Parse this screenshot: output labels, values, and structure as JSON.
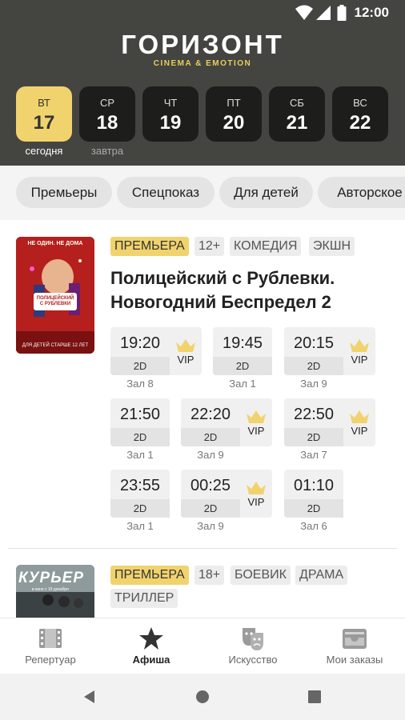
{
  "status_bar": {
    "time": "12:00"
  },
  "brand": {
    "name": "ГОРИЗОНТ",
    "tagline": "CINEMA & EMOTION"
  },
  "days": [
    {
      "weekday": "ВТ",
      "date": "17",
      "label": "сегодня",
      "active": true
    },
    {
      "weekday": "СР",
      "date": "18",
      "label": "завтра",
      "active": false
    },
    {
      "weekday": "ЧТ",
      "date": "19",
      "label": "",
      "active": false
    },
    {
      "weekday": "ПТ",
      "date": "20",
      "label": "",
      "active": false
    },
    {
      "weekday": "СБ",
      "date": "21",
      "label": "",
      "active": false
    },
    {
      "weekday": "ВС",
      "date": "22",
      "label": "",
      "active": false
    }
  ],
  "filters": [
    "Премьеры",
    "Спецпоказ",
    "Для детей",
    "Авторское"
  ],
  "movies": [
    {
      "poster": {
        "top_text": "НЕ ОДИН. НЕ ДОМА",
        "title_text": "ПОЛИЦЕЙСКИЙ С РУБЛЕВКИ",
        "bottom_text": "ДЛЯ ДЕТЕЙ СТАРШЕ 12 ЛЕТ"
      },
      "badges": [
        "ПРЕМЬЕРА",
        "12+",
        "КОМЕДИЯ",
        "ЭКШН"
      ],
      "title_line1": "Полицейский с Рублевки.",
      "title_line2": "Новогодний Беспредел 2",
      "sessions": [
        {
          "time": "19:20",
          "format": "2D",
          "hall": "Зал 8",
          "vip": "VIP"
        },
        {
          "time": "19:45",
          "format": "2D",
          "hall": "Зал 1",
          "vip": ""
        },
        {
          "time": "20:15",
          "format": "2D",
          "hall": "Зал 9",
          "vip": "VIP"
        },
        {
          "time": "21:50",
          "format": "2D",
          "hall": "Зал 1",
          "vip": ""
        },
        {
          "time": "22:20",
          "format": "2D",
          "hall": "Зал 9",
          "vip": "VIP"
        },
        {
          "time": "22:50",
          "format": "2D",
          "hall": "Зал 7",
          "vip": "VIP"
        },
        {
          "time": "23:55",
          "format": "2D",
          "hall": "Зал 1",
          "vip": ""
        },
        {
          "time": "00:25",
          "format": "2D",
          "hall": "Зал 9",
          "vip": "VIP"
        },
        {
          "time": "01:10",
          "format": "2D",
          "hall": "Зал 6",
          "vip": ""
        }
      ]
    },
    {
      "poster": {
        "title_text": "КУРЬЕР",
        "sub_text": "в кино с 19 декабря"
      },
      "badges": [
        "ПРЕМЬЕРА",
        "18+",
        "БОЕВИК",
        "ДРАМА",
        "ТРИЛЛЕР"
      ]
    }
  ],
  "bottom_nav": [
    {
      "label": "Репертуар",
      "icon": "film-icon",
      "active": false
    },
    {
      "label": "Афиша",
      "icon": "star-icon",
      "active": true
    },
    {
      "label": "Искусство",
      "icon": "theater-masks-icon",
      "active": false
    },
    {
      "label": "Мои заказы",
      "icon": "orders-tray-icon",
      "active": false
    }
  ],
  "colors": {
    "header_bg": "#444441",
    "accent": "#f1d36e",
    "day_bg": "#1d1d1b"
  }
}
